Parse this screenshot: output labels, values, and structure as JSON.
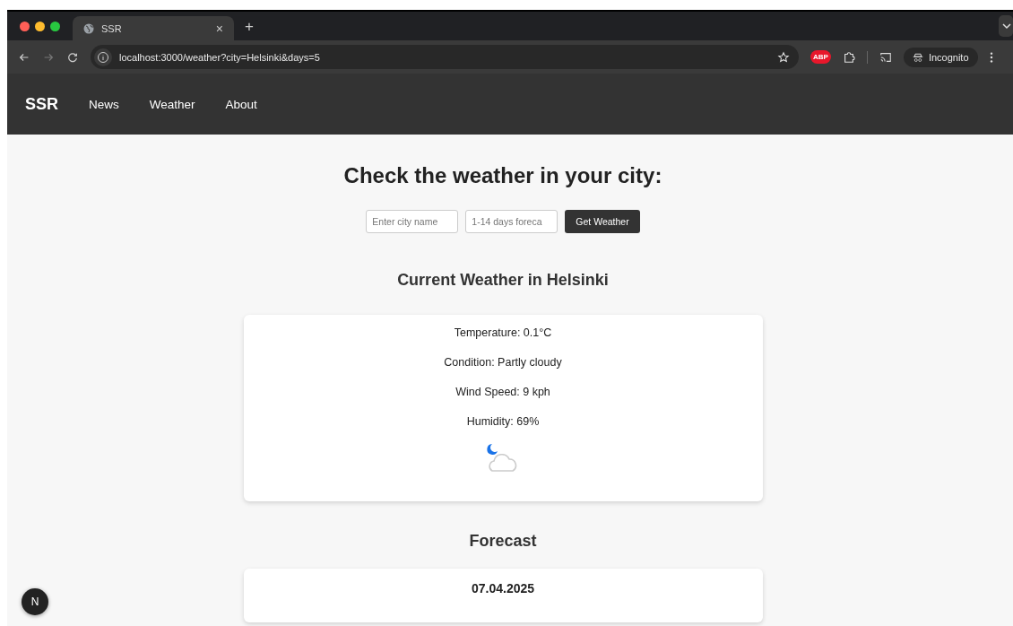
{
  "browser": {
    "tabs": [
      {
        "title": "SSR",
        "selected": true
      }
    ],
    "close_tab": "×",
    "new_tab": "+",
    "url": "localhost:3000/weather?city=Helsinki&days=5",
    "extension_badge": "ABP",
    "profile": "Incognito"
  },
  "nav": {
    "brand": "SSR",
    "links": [
      "News",
      "Weather",
      "About"
    ]
  },
  "heading": "Check the weather in your city:",
  "form": {
    "city": {
      "placeholder": "Enter city name"
    },
    "days": {
      "placeholder": "1-14 days foreca"
    },
    "button": "Get Weather"
  },
  "current": {
    "title": "Current Weather in Helsinki",
    "lines": [
      "Temperature: 0.1°C",
      "Condition: Partly cloudy",
      "Wind Speed: 9 kph",
      "Humidity: 69%"
    ]
  },
  "forecast": {
    "title": "Forecast",
    "days": [
      {
        "date": "07.04.2025"
      }
    ]
  },
  "dev_badge": "N"
}
